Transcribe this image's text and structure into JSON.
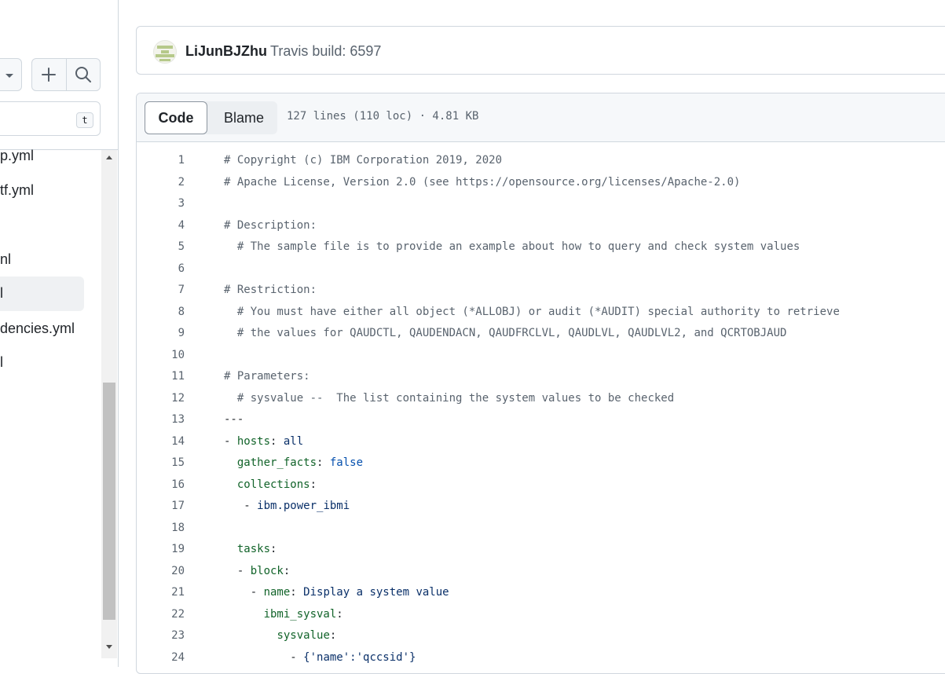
{
  "sidebar": {
    "search_shortcut": "t",
    "items": [
      "p.yml",
      "tf.yml",
      "nl",
      "l",
      "dencies.yml",
      "l"
    ]
  },
  "commit": {
    "author": "LiJunBJZhu",
    "message": "Travis build: 6597"
  },
  "file": {
    "tabs": {
      "code": "Code",
      "blame": "Blame"
    },
    "meta": "127 lines (110 loc) · 4.81 KB",
    "lines": [
      {
        "n": "1",
        "t": "# Copyright (c) IBM Corporation 2019, 2020"
      },
      {
        "n": "2",
        "t": "# Apache License, Version 2.0 (see https://opensource.org/licenses/Apache-2.0)"
      },
      {
        "n": "3",
        "t": ""
      },
      {
        "n": "4",
        "t": "# Description:"
      },
      {
        "n": "5",
        "t": "  # The sample file is to provide an example about how to query and check system values"
      },
      {
        "n": "6",
        "t": ""
      },
      {
        "n": "7",
        "t": "# Restriction:"
      },
      {
        "n": "8",
        "t": "  # You must have either all object (*ALLOBJ) or audit (*AUDIT) special authority to retrieve"
      },
      {
        "n": "9",
        "t": "  # the values for QAUDCTL, QAUDENDACN, QAUDFRCLVL, QAUDLVL, QAUDLVL2, and QCRTOBJAUD"
      },
      {
        "n": "10",
        "t": ""
      },
      {
        "n": "11",
        "t": "# Parameters:"
      },
      {
        "n": "12",
        "t": "  # sysvalue --  The list containing the system values to be checked"
      },
      {
        "n": "13",
        "t": "---"
      },
      {
        "n": "14",
        "t": "- hosts: all"
      },
      {
        "n": "15",
        "t": "  gather_facts: false"
      },
      {
        "n": "16",
        "t": "  collections:"
      },
      {
        "n": "17",
        "t": "   - ibm.power_ibmi"
      },
      {
        "n": "18",
        "t": ""
      },
      {
        "n": "19",
        "t": "  tasks:"
      },
      {
        "n": "20",
        "t": "  - block:"
      },
      {
        "n": "21",
        "t": "    - name: Display a system value"
      },
      {
        "n": "22",
        "t": "      ibmi_sysval:"
      },
      {
        "n": "23",
        "t": "        sysvalue:"
      },
      {
        "n": "24",
        "t": "          - {'name':'qccsid'}"
      }
    ]
  }
}
